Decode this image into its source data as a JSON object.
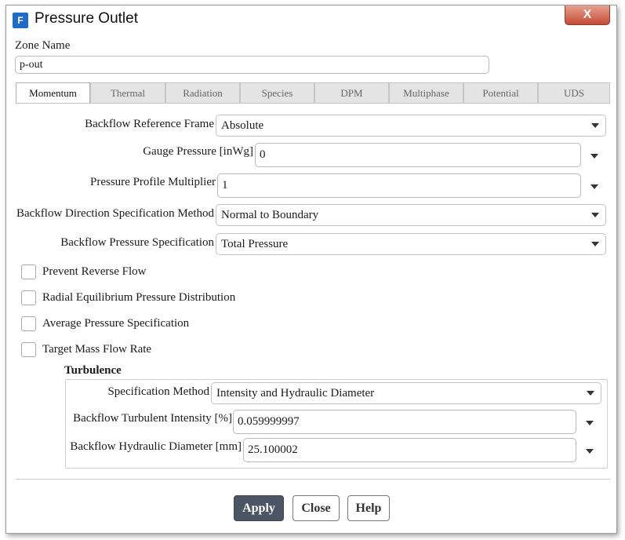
{
  "window": {
    "title": "Pressure Outlet",
    "app_icon_letter": "F",
    "close_label": "X"
  },
  "zone": {
    "label": "Zone Name",
    "value": "p-out"
  },
  "tabs": [
    {
      "label": "Momentum",
      "active": true
    },
    {
      "label": "Thermal",
      "active": false
    },
    {
      "label": "Radiation",
      "active": false
    },
    {
      "label": "Species",
      "active": false
    },
    {
      "label": "DPM",
      "active": false
    },
    {
      "label": "Multiphase",
      "active": false
    },
    {
      "label": "Potential",
      "active": false
    },
    {
      "label": "UDS",
      "active": false
    }
  ],
  "momentum": {
    "backflow_reference_frame": {
      "label": "Backflow Reference Frame",
      "value": "Absolute"
    },
    "gauge_pressure": {
      "label": "Gauge Pressure [inWg]",
      "value": "0"
    },
    "pressure_profile_multiplier": {
      "label": "Pressure Profile Multiplier",
      "value": "1"
    },
    "backflow_direction": {
      "label": "Backflow Direction Specification Method",
      "value": "Normal to Boundary"
    },
    "backflow_pressure_spec": {
      "label": "Backflow Pressure Specification",
      "value": "Total Pressure"
    },
    "checkboxes": [
      {
        "label": "Prevent Reverse Flow",
        "checked": false
      },
      {
        "label": "Radial Equilibrium Pressure Distribution",
        "checked": false
      },
      {
        "label": "Average Pressure Specification",
        "checked": false
      },
      {
        "label": "Target Mass Flow Rate",
        "checked": false
      }
    ]
  },
  "turbulence": {
    "heading": "Turbulence",
    "specification_method": {
      "label": "Specification Method",
      "value": "Intensity and Hydraulic Diameter"
    },
    "backflow_turbulent_intensity": {
      "label": "Backflow Turbulent Intensity [%]",
      "value": "0.059999997"
    },
    "backflow_hydraulic_diameter": {
      "label": "Backflow Hydraulic Diameter [mm]",
      "value": "25.100002"
    }
  },
  "buttons": {
    "apply": "Apply",
    "close": "Close",
    "help": "Help"
  },
  "colors": {
    "apply_bg": "#4b5563",
    "close_titlebar": "#c64b35",
    "app_icon": "#1e6bc8"
  }
}
